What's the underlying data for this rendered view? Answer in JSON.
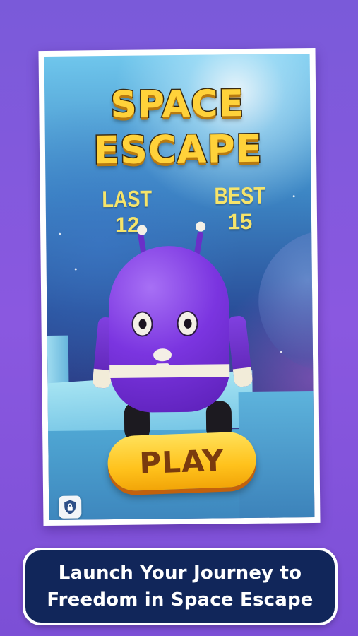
{
  "game": {
    "title_line1": "SPACE",
    "title_line2": "ESCAPE",
    "last_label": "LAST",
    "last_value": "12",
    "best_label": "BEST",
    "best_value": "15",
    "play_label": "PLAY",
    "character": "purple-robot",
    "privacy_icon": "shield-lock-icon"
  },
  "caption": {
    "line1": "Launch Your Journey to",
    "line2": "Freedom in Space Escape"
  },
  "colors": {
    "background": "#7a5ad9",
    "title": "#ffd23a",
    "score_text": "#f6e46a",
    "play_button": "#ffc21c",
    "caption_box": "#11265a"
  }
}
